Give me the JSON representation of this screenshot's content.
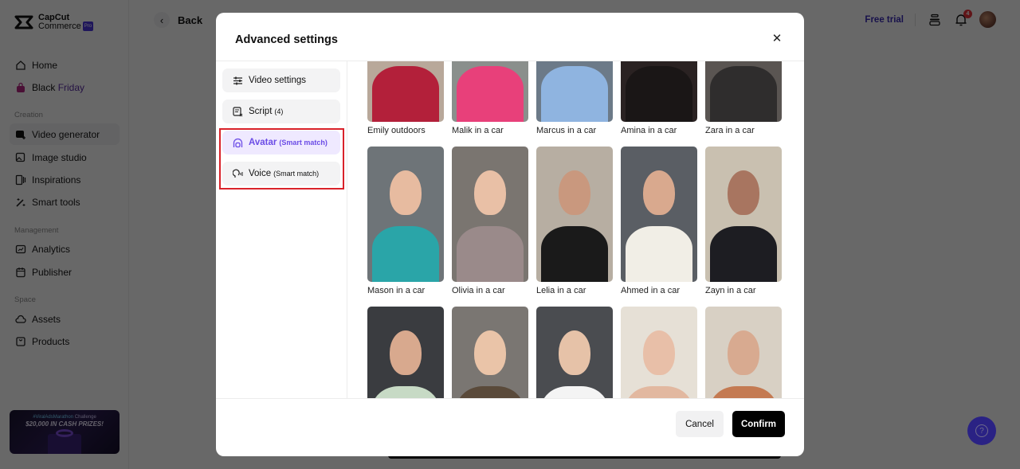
{
  "app": {
    "logo_line1": "CapCut",
    "logo_line2": "Commerce",
    "logo_badge": "Pro"
  },
  "sidebar": {
    "items_top": [
      {
        "label": "Home",
        "icon": "home-icon"
      },
      {
        "label_part1": "Black ",
        "label_part2": "Friday",
        "icon": "shopping-bag-icon"
      }
    ],
    "sections": [
      {
        "title": "Creation",
        "items": [
          {
            "label": "Video generator",
            "icon": "video-plus-icon",
            "active": true
          },
          {
            "label": "Image studio",
            "icon": "image-sparkle-icon"
          },
          {
            "label": "Inspirations",
            "icon": "inspirations-icon"
          },
          {
            "label": "Smart tools",
            "icon": "magic-wand-icon"
          }
        ]
      },
      {
        "title": "Management",
        "items": [
          {
            "label": "Analytics",
            "icon": "chart-icon"
          },
          {
            "label": "Publisher",
            "icon": "calendar-icon"
          }
        ]
      },
      {
        "title": "Space",
        "items": [
          {
            "label": "Assets",
            "icon": "cloud-icon"
          },
          {
            "label": "Products",
            "icon": "box-icon"
          }
        ]
      }
    ],
    "promo": {
      "hashtag": "#ViralAdsMarathon",
      "line1_rest": " Challenge",
      "line2": "$20,000 IN CASH PRIZES!"
    }
  },
  "header": {
    "back_label": "Back",
    "free_trial": "Free trial",
    "notification_count": "4"
  },
  "modal": {
    "title": "Advanced settings",
    "tabs": [
      {
        "label": "Video settings",
        "suffix": "",
        "icon": "sliders-icon"
      },
      {
        "label": "Script",
        "suffix": "(4)",
        "icon": "script-icon"
      },
      {
        "label": "Avatar",
        "suffix": "(Smart match)",
        "icon": "avatar-icon",
        "active": true
      },
      {
        "label": "Voice",
        "suffix": "(Smart match)",
        "icon": "voice-icon"
      }
    ],
    "avatars_row1": [
      "Emily outdoors",
      "Malik in a car",
      "Marcus in a car",
      "Amina in a car",
      "Zara in a car"
    ],
    "avatars_row2": [
      "Mason in a car",
      "Olivia in a car",
      "Lelia in a car",
      "Ahmed in a car",
      "Zayn in a car"
    ],
    "avatars_row3": [
      "",
      "",
      "",
      "",
      ""
    ],
    "cancel_label": "Cancel",
    "confirm_label": "Confirm"
  },
  "colors": {
    "accent_purple": "#6b4ce6",
    "brand_blue": "#3b2bb4",
    "highlight_red": "#d9222a",
    "confirm_black": "#000000"
  }
}
